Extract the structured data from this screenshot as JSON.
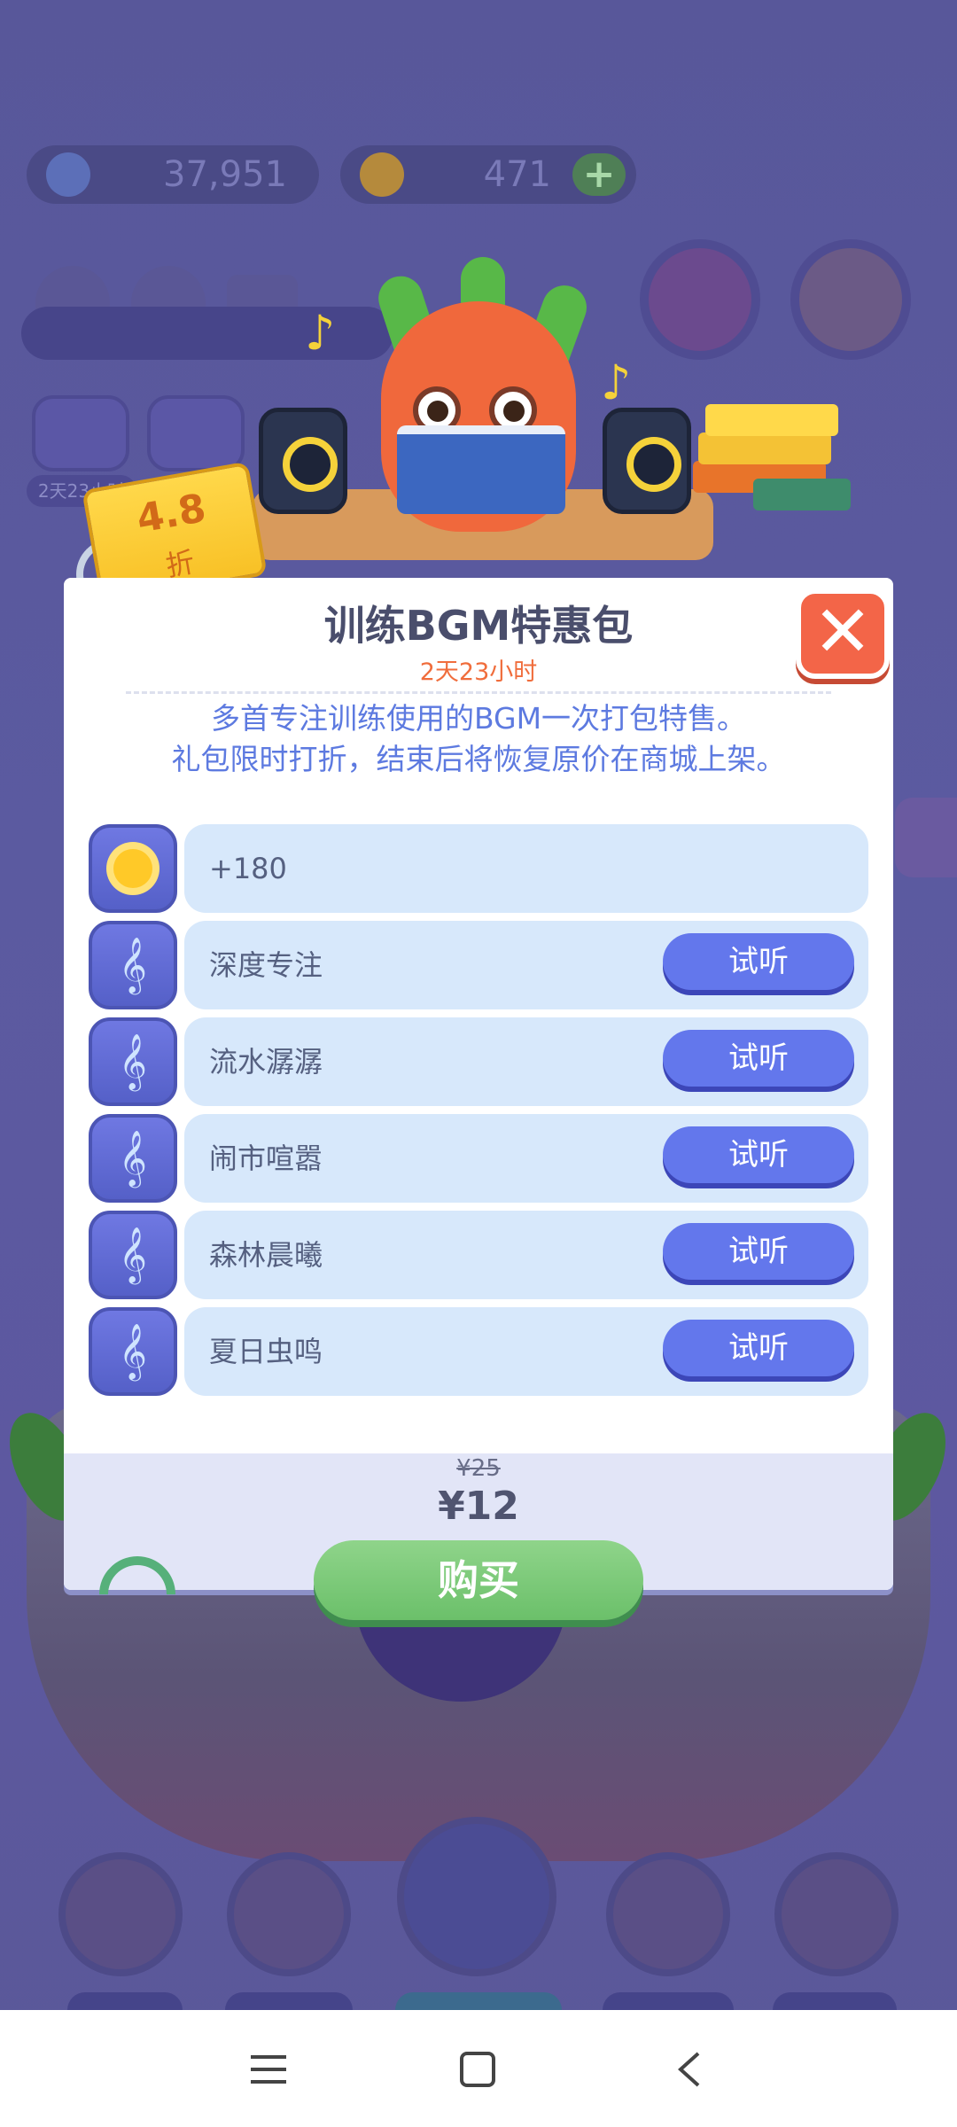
{
  "currency": {
    "water_amount": "37,951",
    "sun_amount": "471",
    "add_label": "+"
  },
  "limited": {
    "timer": "2天23小时"
  },
  "tag": {
    "discount": "4.8",
    "unit": "折"
  },
  "dialog": {
    "title": "训练BGM特惠包",
    "timer": "2天23小时",
    "description_line1": "多首专注训练使用的BGM一次打包特售。",
    "description_line2": "礼包限时打折，结束后将恢复原价在商城上架。",
    "close_label": "✕",
    "items": [
      {
        "icon": "sun-icon",
        "label": "+180",
        "has_listen": false
      },
      {
        "icon": "music-note-icon",
        "label": "深度专注",
        "has_listen": true,
        "listen_label": "试听"
      },
      {
        "icon": "music-note-icon",
        "label": "流水潺潺",
        "has_listen": true,
        "listen_label": "试听"
      },
      {
        "icon": "music-note-icon",
        "label": "闹市喧嚣",
        "has_listen": true,
        "listen_label": "试听"
      },
      {
        "icon": "music-note-icon",
        "label": "森林晨曦",
        "has_listen": true,
        "listen_label": "试听"
      },
      {
        "icon": "music-note-icon",
        "label": "夏日虫鸣",
        "has_listen": true,
        "listen_label": "试听"
      }
    ],
    "original_price": "¥25",
    "price": "¥12",
    "buy_label": "购买"
  },
  "system_nav": {
    "menu_icon": "menu-icon",
    "home_icon": "home-square-icon",
    "back_icon": "back-chevron-icon"
  },
  "colors": {
    "accent": "#6377ec",
    "title": "#4a4e6c",
    "timer": "#f06d3c",
    "description": "#5d7ae0",
    "close": "#f36548",
    "buy": "#6bc06a"
  }
}
